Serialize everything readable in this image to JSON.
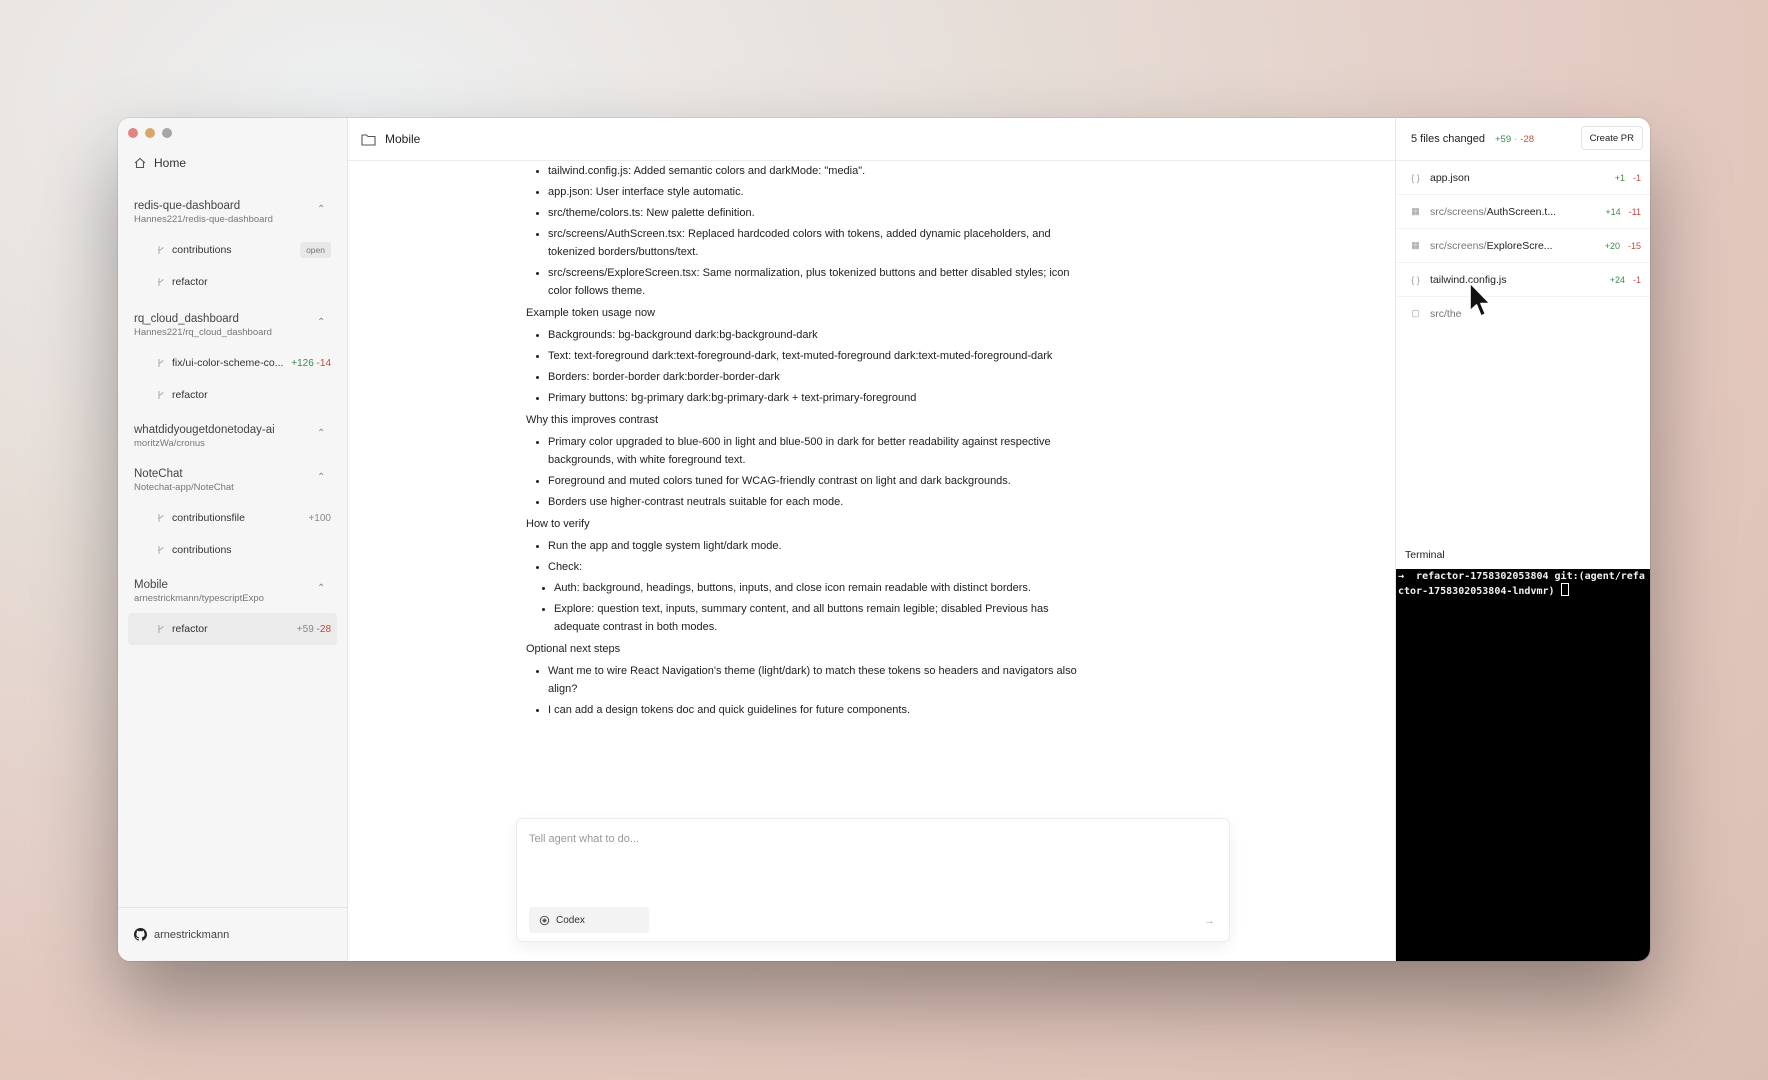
{
  "sidebar": {
    "home_label": "Home",
    "projects": [
      {
        "name": "redis-que-dashboard",
        "repo": "Hannes221/redis-que-dashboard",
        "branches": [
          {
            "name": "contributions",
            "badge": "open",
            "plus": "",
            "minus": ""
          },
          {
            "name": "refactor",
            "badge": "",
            "plus": "",
            "minus": ""
          }
        ]
      },
      {
        "name": "rq_cloud_dashboard",
        "repo": "Hannes221/rq_cloud_dashboard",
        "branches": [
          {
            "name": "fix/ui-color-scheme-co...",
            "badge": "",
            "plus": "+126",
            "minus": "-14"
          },
          {
            "name": "refactor",
            "badge": "",
            "plus": "",
            "minus": ""
          }
        ]
      },
      {
        "name": "whatdidyougetdonetoday-ai",
        "repo": "moritzWa/cronus",
        "branches": []
      },
      {
        "name": "NoteChat",
        "repo": "Notechat-app/NoteChat",
        "branches": [
          {
            "name": "contributionsfile",
            "badge": "",
            "plus": "+100",
            "minus": ""
          },
          {
            "name": "contributions",
            "badge": "",
            "plus": "",
            "minus": ""
          }
        ]
      },
      {
        "name": "Mobile",
        "repo": "arnestrickmann/typescriptExpo",
        "branches": [
          {
            "name": "refactor",
            "badge": "",
            "plus": "+59",
            "minus": "-28",
            "active": true
          }
        ]
      }
    ],
    "user": "arnestrickmann"
  },
  "main": {
    "title": "Mobile",
    "content": {
      "bullets_1": [
        "tailwind.config.js: Added semantic colors and darkMode: \"media\".",
        "app.json: User interface style automatic.",
        "src/theme/colors.ts: New palette definition.",
        "src/screens/AuthScreen.tsx: Replaced hardcoded colors with tokens, added dynamic placeholders, and tokenized borders/buttons/text.",
        "src/screens/ExploreScreen.tsx: Same normalization, plus tokenized buttons and better disabled styles; icon color follows theme."
      ],
      "heading_2": "Example token usage now",
      "bullets_2": [
        "Backgrounds: bg-background dark:bg-background-dark",
        "Text: text-foreground dark:text-foreground-dark, text-muted-foreground dark:text-muted-foreground-dark",
        "Borders: border-border dark:border-border-dark",
        "Primary buttons: bg-primary dark:bg-primary-dark + text-primary-foreground"
      ],
      "heading_3": "Why this improves contrast",
      "bullets_3": [
        "Primary color upgraded to blue-600 in light and blue-500 in dark for better readability against respective backgrounds, with white foreground text.",
        "Foreground and muted colors tuned for WCAG-friendly contrast on light and dark backgrounds.",
        "Borders use higher-contrast neutrals suitable for each mode."
      ],
      "heading_4": "How to verify",
      "bullets_4": [
        "Run the app and toggle system light/dark mode.",
        "Check:"
      ],
      "bullets_4b": [
        "Auth: background, headings, buttons, inputs, and close icon remain readable with distinct borders.",
        "Explore: question text, inputs, summary content, and all buttons remain legible; disabled Previous has adequate contrast in both modes."
      ],
      "heading_5": "Optional next steps",
      "bullets_5": [
        "Want me to wire React Navigation's theme (light/dark) to match these tokens so headers and navigators also align?",
        "I can add a design tokens doc and quick guidelines for future components."
      ]
    },
    "composer": {
      "placeholder": "Tell agent what to do...",
      "model": "Codex",
      "send_icon": "arrow-right-icon"
    }
  },
  "right": {
    "summary": "5 files changed",
    "plus": "+59",
    "sep": "·",
    "minus": "-28",
    "create_pr": "Create PR",
    "files": [
      {
        "icon": "braces",
        "dir": "",
        "name": "app.json",
        "plus": "+1",
        "minus": "-1"
      },
      {
        "icon": "grid",
        "dir": "src/screens/",
        "name": "AuthScreen.t...",
        "plus": "+14",
        "minus": "-11"
      },
      {
        "icon": "grid",
        "dir": "src/screens/",
        "name": "ExploreScre...",
        "plus": "+20",
        "minus": "-15"
      },
      {
        "icon": "braces",
        "dir": "",
        "name": "tailwind.config.js",
        "plus": "+24",
        "minus": "-1"
      },
      {
        "icon": "file",
        "dir": "src/the",
        "name": "",
        "plus": "",
        "minus": ""
      }
    ],
    "terminal_label": "Terminal",
    "terminal_text": "→  refactor-1758302053804 git:(agent/refactor-1758302053804-lndvmr) "
  },
  "colors": {
    "plus": "#3c8a4e",
    "minus": "#c44a3f",
    "terminal_bg": "#000000"
  }
}
